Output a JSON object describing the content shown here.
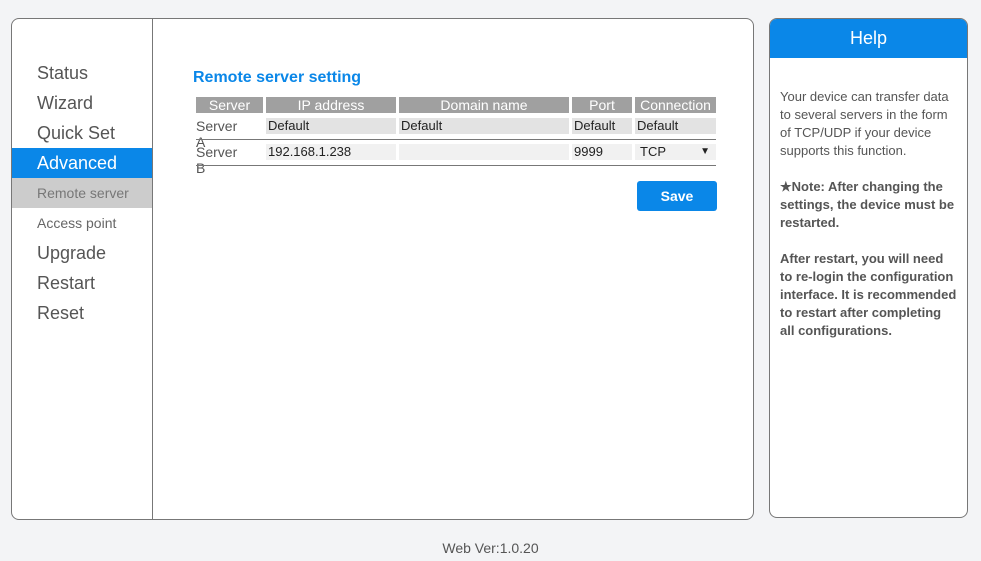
{
  "nav": {
    "items": [
      "Status",
      "Wizard",
      "Quick Set",
      "Advanced",
      "Remote server",
      "Access point",
      "Upgrade",
      "Restart",
      "Reset"
    ]
  },
  "section_title": "Remote server setting",
  "table": {
    "headers": [
      "Server",
      "IP address",
      "Domain name",
      "Port",
      "Connection"
    ],
    "rows": [
      {
        "server": "Server A",
        "ip": "Default",
        "domain": "Default",
        "port": "Default",
        "connection": "Default"
      },
      {
        "server": "Server B",
        "ip": "192.168.1.238",
        "domain": "",
        "port": "9999",
        "connection": "TCP"
      }
    ]
  },
  "save_label": "Save",
  "help": {
    "title": "Help",
    "p1": "Your device can transfer data to several servers in the form of TCP/UDP if your device supports this function.",
    "note": "★Note: After changing the settings, the device must be restarted.",
    "p3": "After restart, you will need to re-login the configuration interface. It is recommended to restart after completing all configurations."
  },
  "footer": "Web Ver:1.0.20"
}
